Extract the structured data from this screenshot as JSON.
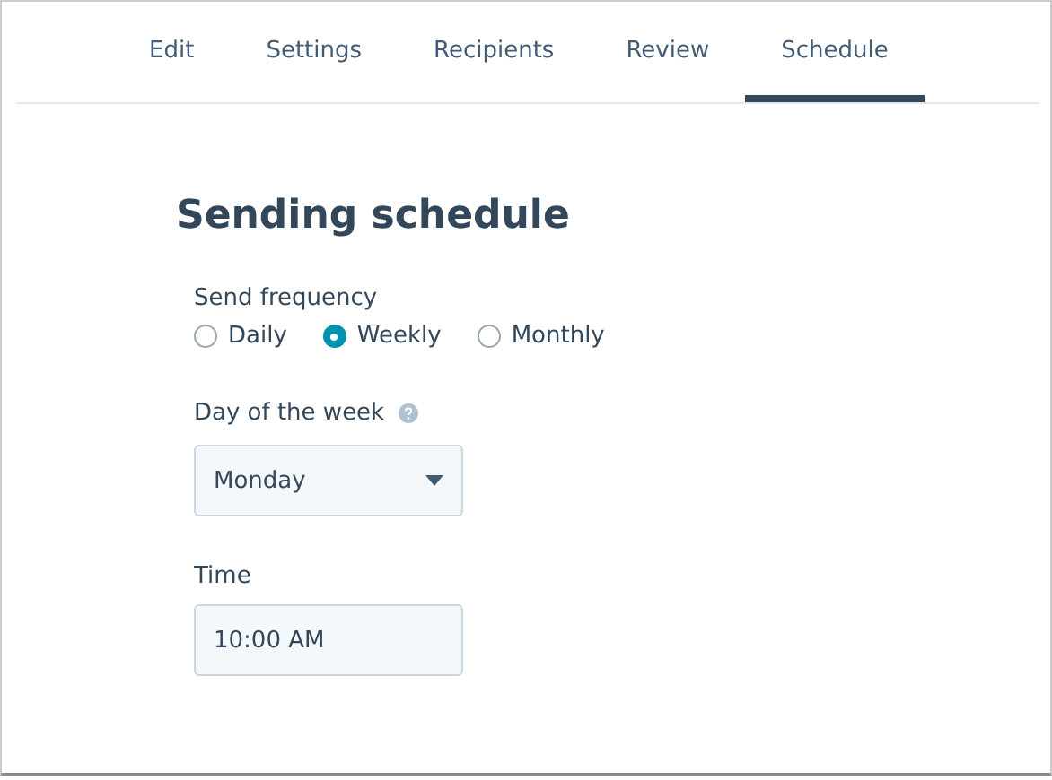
{
  "tabs": [
    {
      "label": "Edit",
      "selected": false
    },
    {
      "label": "Settings",
      "selected": false
    },
    {
      "label": "Recipients",
      "selected": false
    },
    {
      "label": "Review",
      "selected": false
    },
    {
      "label": "Schedule",
      "selected": true
    }
  ],
  "heading": "Sending schedule",
  "frequency": {
    "label": "Send frequency",
    "options": [
      {
        "label": "Daily",
        "selected": false
      },
      {
        "label": "Weekly",
        "selected": true
      },
      {
        "label": "Monthly",
        "selected": false
      }
    ]
  },
  "day": {
    "label": "Day of the week",
    "value": "Monday"
  },
  "time": {
    "label": "Time",
    "value": "10:00 AM"
  }
}
